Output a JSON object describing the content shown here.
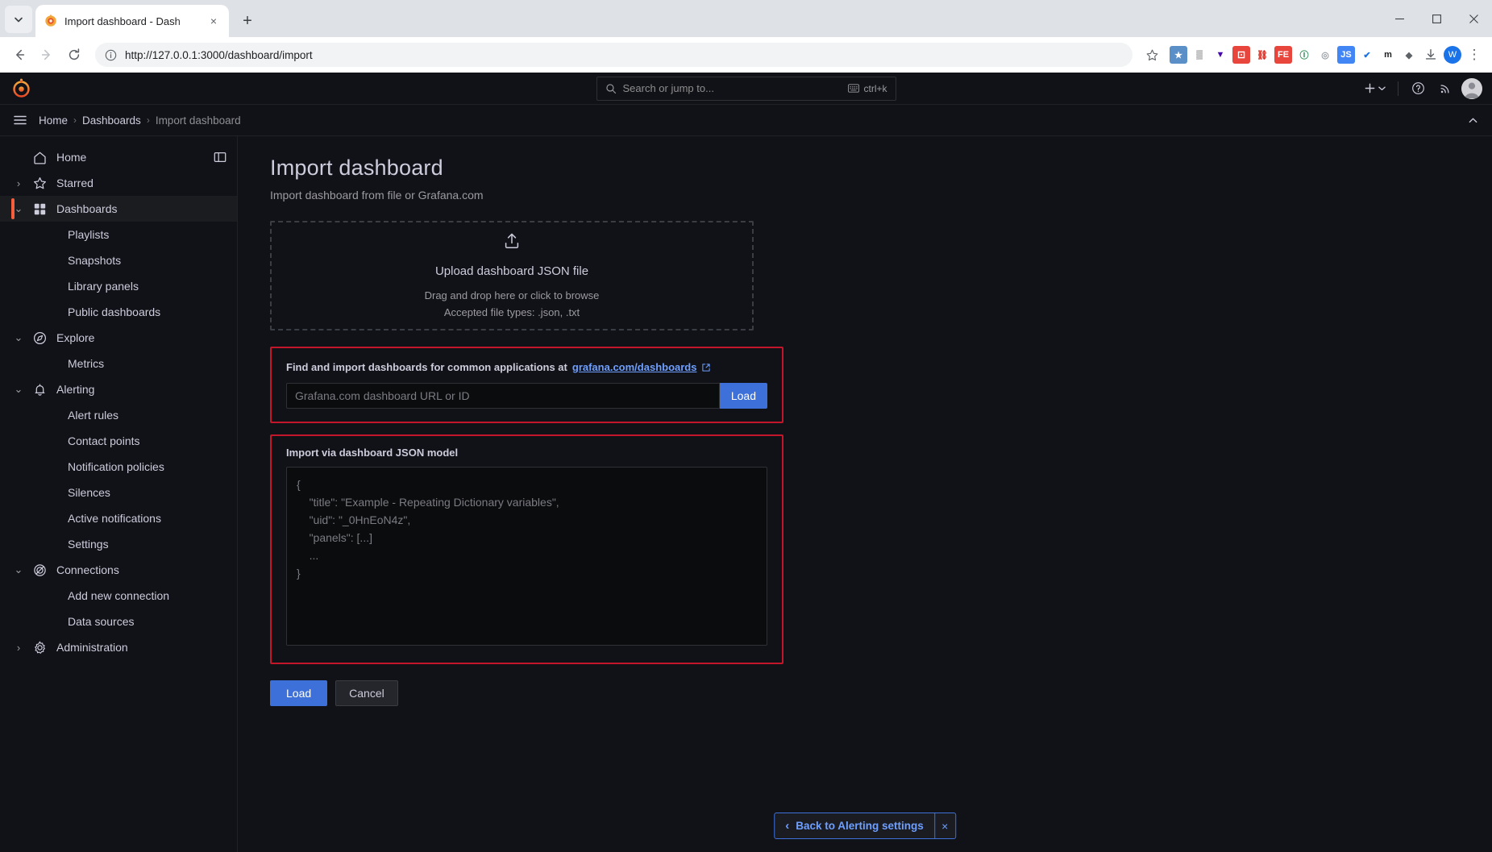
{
  "browser": {
    "tab": {
      "title": "Import dashboard - Dash",
      "favicon": "grafana-icon",
      "close_label": "×"
    },
    "new_tab_label": "+",
    "tab_list_label": "⌄",
    "window": {
      "minimize": "–",
      "maximize": "❐",
      "close": "✕"
    },
    "nav": {
      "back": "←",
      "forward": "→",
      "reload": "↻"
    },
    "omnibox": {
      "url": "http://127.0.0.1:3000/dashboard/import",
      "site_info_icon": "info-circle-icon",
      "bookmark_icon": "star-icon"
    },
    "extensions": [
      {
        "name": "bookmark-manager-extension",
        "glyph": "★",
        "bg": "#5b8fc7",
        "fg": "#ffffff"
      },
      {
        "name": "qr-code-extension",
        "glyph": "▒",
        "bg": "#ffffff",
        "fg": "#202124"
      },
      {
        "name": "wappalyzer-extension",
        "glyph": "▼",
        "bg": "#ffffff",
        "fg": "#4608ad"
      },
      {
        "name": "dice-extension",
        "glyph": "⚀",
        "bg": "#e8453c",
        "fg": "#ffffff"
      },
      {
        "name": "sitemap-extension",
        "glyph": "⛓",
        "bg": "#ffffff",
        "fg": "#d93025"
      },
      {
        "name": "fe-extension",
        "glyph": "FE",
        "bg": "#e8453c",
        "fg": "#ffffff"
      },
      {
        "name": "shield-extension",
        "glyph": "Ⓘ",
        "bg": "#ffffff",
        "fg": "#2e8b57"
      },
      {
        "name": "disabled-extension",
        "glyph": "◎",
        "bg": "#ffffff",
        "fg": "#9aa0a6"
      },
      {
        "name": "javascript-extension",
        "glyph": "JS",
        "bg": "#4285f4",
        "fg": "#ffffff"
      },
      {
        "name": "verify-extension",
        "glyph": "✔",
        "bg": "#ffffff",
        "fg": "#1a73e8"
      },
      {
        "name": "m-extension",
        "glyph": "m",
        "bg": "#ffffff",
        "fg": "#202124"
      },
      {
        "name": "puzzle-extension",
        "glyph": "◆",
        "bg": "#ffffff",
        "fg": "#5f6368"
      }
    ],
    "toolbar_icons": [
      {
        "name": "extensions-icon",
        "glyph": "⧉"
      },
      {
        "name": "downloads-icon",
        "glyph": "⤓"
      }
    ],
    "profile_initial": "W",
    "menu_icon": "⋮"
  },
  "grafana": {
    "logo": "grafana-logo",
    "search": {
      "placeholder": "Search or jump to...",
      "shortcut": "ctrl+k",
      "icon": "search-icon"
    },
    "top_right": {
      "add_label": "+",
      "add_chevron": "⌄",
      "help_icon": "help-circle-icon",
      "news_icon": "news-rss-icon",
      "avatar": "user-avatar"
    },
    "breadcrumbs": [
      {
        "label": "Home",
        "current": false
      },
      {
        "label": "Dashboards",
        "current": false
      },
      {
        "label": "Import dashboard",
        "current": true
      }
    ],
    "breadcrumb_separator": "›",
    "menu_icon": "hamburger-menu-icon",
    "collapse_icon": "chevron-up-icon",
    "sidebar": {
      "dock_icon": "dock-menu-icon",
      "items": [
        {
          "label": "Home",
          "icon": "home-icon",
          "chevron": "",
          "child": false,
          "active": false,
          "dock": true
        },
        {
          "label": "Starred",
          "icon": "star-icon",
          "chevron": "›",
          "child": false,
          "active": false
        },
        {
          "label": "Dashboards",
          "icon": "dashboards-grid-icon",
          "chevron": "⌄",
          "child": false,
          "active": true
        },
        {
          "label": "Playlists",
          "icon": "",
          "chevron": "",
          "child": true,
          "active": false
        },
        {
          "label": "Snapshots",
          "icon": "",
          "chevron": "",
          "child": true,
          "active": false
        },
        {
          "label": "Library panels",
          "icon": "",
          "chevron": "",
          "child": true,
          "active": false
        },
        {
          "label": "Public dashboards",
          "icon": "",
          "chevron": "",
          "child": true,
          "active": false
        },
        {
          "label": "Explore",
          "icon": "compass-icon",
          "chevron": "⌄",
          "child": false,
          "active": false
        },
        {
          "label": "Metrics",
          "icon": "",
          "chevron": "",
          "child": true,
          "active": false
        },
        {
          "label": "Alerting",
          "icon": "bell-icon",
          "chevron": "⌄",
          "child": false,
          "active": false
        },
        {
          "label": "Alert rules",
          "icon": "",
          "chevron": "",
          "child": true,
          "active": false
        },
        {
          "label": "Contact points",
          "icon": "",
          "chevron": "",
          "child": true,
          "active": false
        },
        {
          "label": "Notification policies",
          "icon": "",
          "chevron": "",
          "child": true,
          "active": false
        },
        {
          "label": "Silences",
          "icon": "",
          "chevron": "",
          "child": true,
          "active": false
        },
        {
          "label": "Active notifications",
          "icon": "",
          "chevron": "",
          "child": true,
          "active": false
        },
        {
          "label": "Settings",
          "icon": "",
          "chevron": "",
          "child": true,
          "active": false
        },
        {
          "label": "Connections",
          "icon": "connections-icon",
          "chevron": "⌄",
          "child": false,
          "active": false
        },
        {
          "label": "Add new connection",
          "icon": "",
          "chevron": "",
          "child": true,
          "active": false
        },
        {
          "label": "Data sources",
          "icon": "",
          "chevron": "",
          "child": true,
          "active": false
        },
        {
          "label": "Administration",
          "icon": "gear-icon",
          "chevron": "›",
          "child": false,
          "active": false
        }
      ]
    },
    "page": {
      "title": "Import dashboard",
      "subtitle": "Import dashboard from file or Grafana.com",
      "dropzone": {
        "icon": "upload-icon",
        "title": "Upload dashboard JSON file",
        "line1": "Drag and drop here or click to browse",
        "line2": "Accepted file types: .json, .txt"
      },
      "grafana_com": {
        "label_prefix": "Find and import dashboards for common applications at",
        "link_text": "grafana.com/dashboards",
        "link_icon": "external-link-icon",
        "input_placeholder": "Grafana.com dashboard URL or ID",
        "input_value": "",
        "load_label": "Load"
      },
      "json_model": {
        "label": "Import via dashboard JSON model",
        "placeholder": "{\n    \"title\": \"Example - Repeating Dictionary variables\",\n    \"uid\": \"_0HnEoN4z\",\n    \"panels\": [...]\n    ...\n}",
        "value": ""
      },
      "actions": {
        "load_label": "Load",
        "cancel_label": "Cancel"
      }
    },
    "return_bar": {
      "chevron": "‹",
      "label": "Back to Alerting settings",
      "close": "×"
    },
    "colors": {
      "accent_orange": "#f55f3e",
      "primary_blue": "#3d71d9",
      "link_blue": "#6e9fff",
      "highlight_red": "#c4162a",
      "bg": "#111217",
      "text": "#ccccdc"
    }
  }
}
